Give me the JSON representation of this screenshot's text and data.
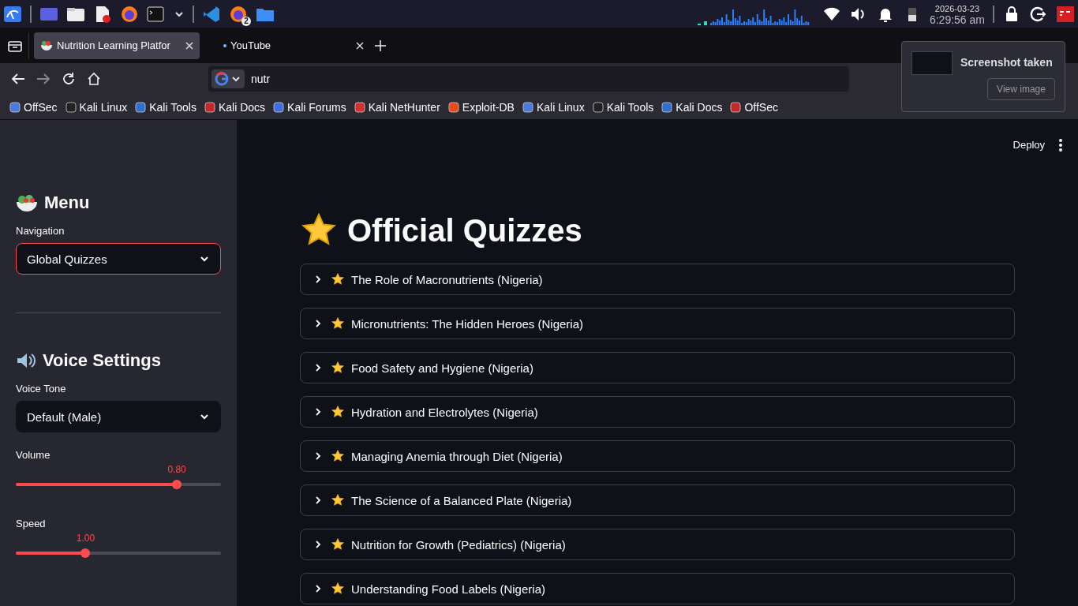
{
  "taskbar": {
    "badge": "2",
    "date": "2026-03-23",
    "time": "6:29:56 am"
  },
  "browser": {
    "tabs": [
      {
        "title": "Nutrition Learning Platfor",
        "selected": true
      },
      {
        "title": "YouTube",
        "selected": false
      }
    ],
    "address": "nutr",
    "bookmarks": [
      "OffSec",
      "Kali Linux",
      "Kali Tools",
      "Kali Docs",
      "Kali Forums",
      "Kali NetHunter",
      "Exploit-DB",
      "Kali Linux",
      "Kali Tools",
      "Kali Docs",
      "OffSec"
    ]
  },
  "notification": {
    "title": "Screenshot taken",
    "button": "View image"
  },
  "app": {
    "deploy": "Deploy",
    "sidebar": {
      "heading": "Menu",
      "navigation": {
        "label": "Navigation",
        "value": "Global Quizzes",
        "focused": true
      },
      "voice_heading": "Voice Settings",
      "voice_tone": {
        "label": "Voice Tone",
        "value": "Default (Male)",
        "focused": false
      },
      "sliders": [
        {
          "label": "Volume",
          "reading": "0.80",
          "level": 0.785
        },
        {
          "label": "Speed",
          "reading": "1.00",
          "level": 0.34
        }
      ]
    },
    "title": "Official Quizzes",
    "quizzes": [
      {
        "title": "The Role of Macronutrients (Nigeria)",
        "expanded": false
      },
      {
        "title": "Micronutrients: The Hidden Heroes (Nigeria)",
        "expanded": false
      },
      {
        "title": "Food Safety and Hygiene (Nigeria)",
        "expanded": false
      },
      {
        "title": "Hydration and Electrolytes (Nigeria)",
        "expanded": false
      },
      {
        "title": "Managing Anemia through Diet (Nigeria)",
        "expanded": false
      },
      {
        "title": "The Science of a Balanced Plate (Nigeria)",
        "expanded": false
      },
      {
        "title": "Nutrition for Growth (Pediatrics) (Nigeria)",
        "expanded": false
      },
      {
        "title": "Understanding Food Labels (Nigeria)",
        "expanded": false
      }
    ]
  }
}
